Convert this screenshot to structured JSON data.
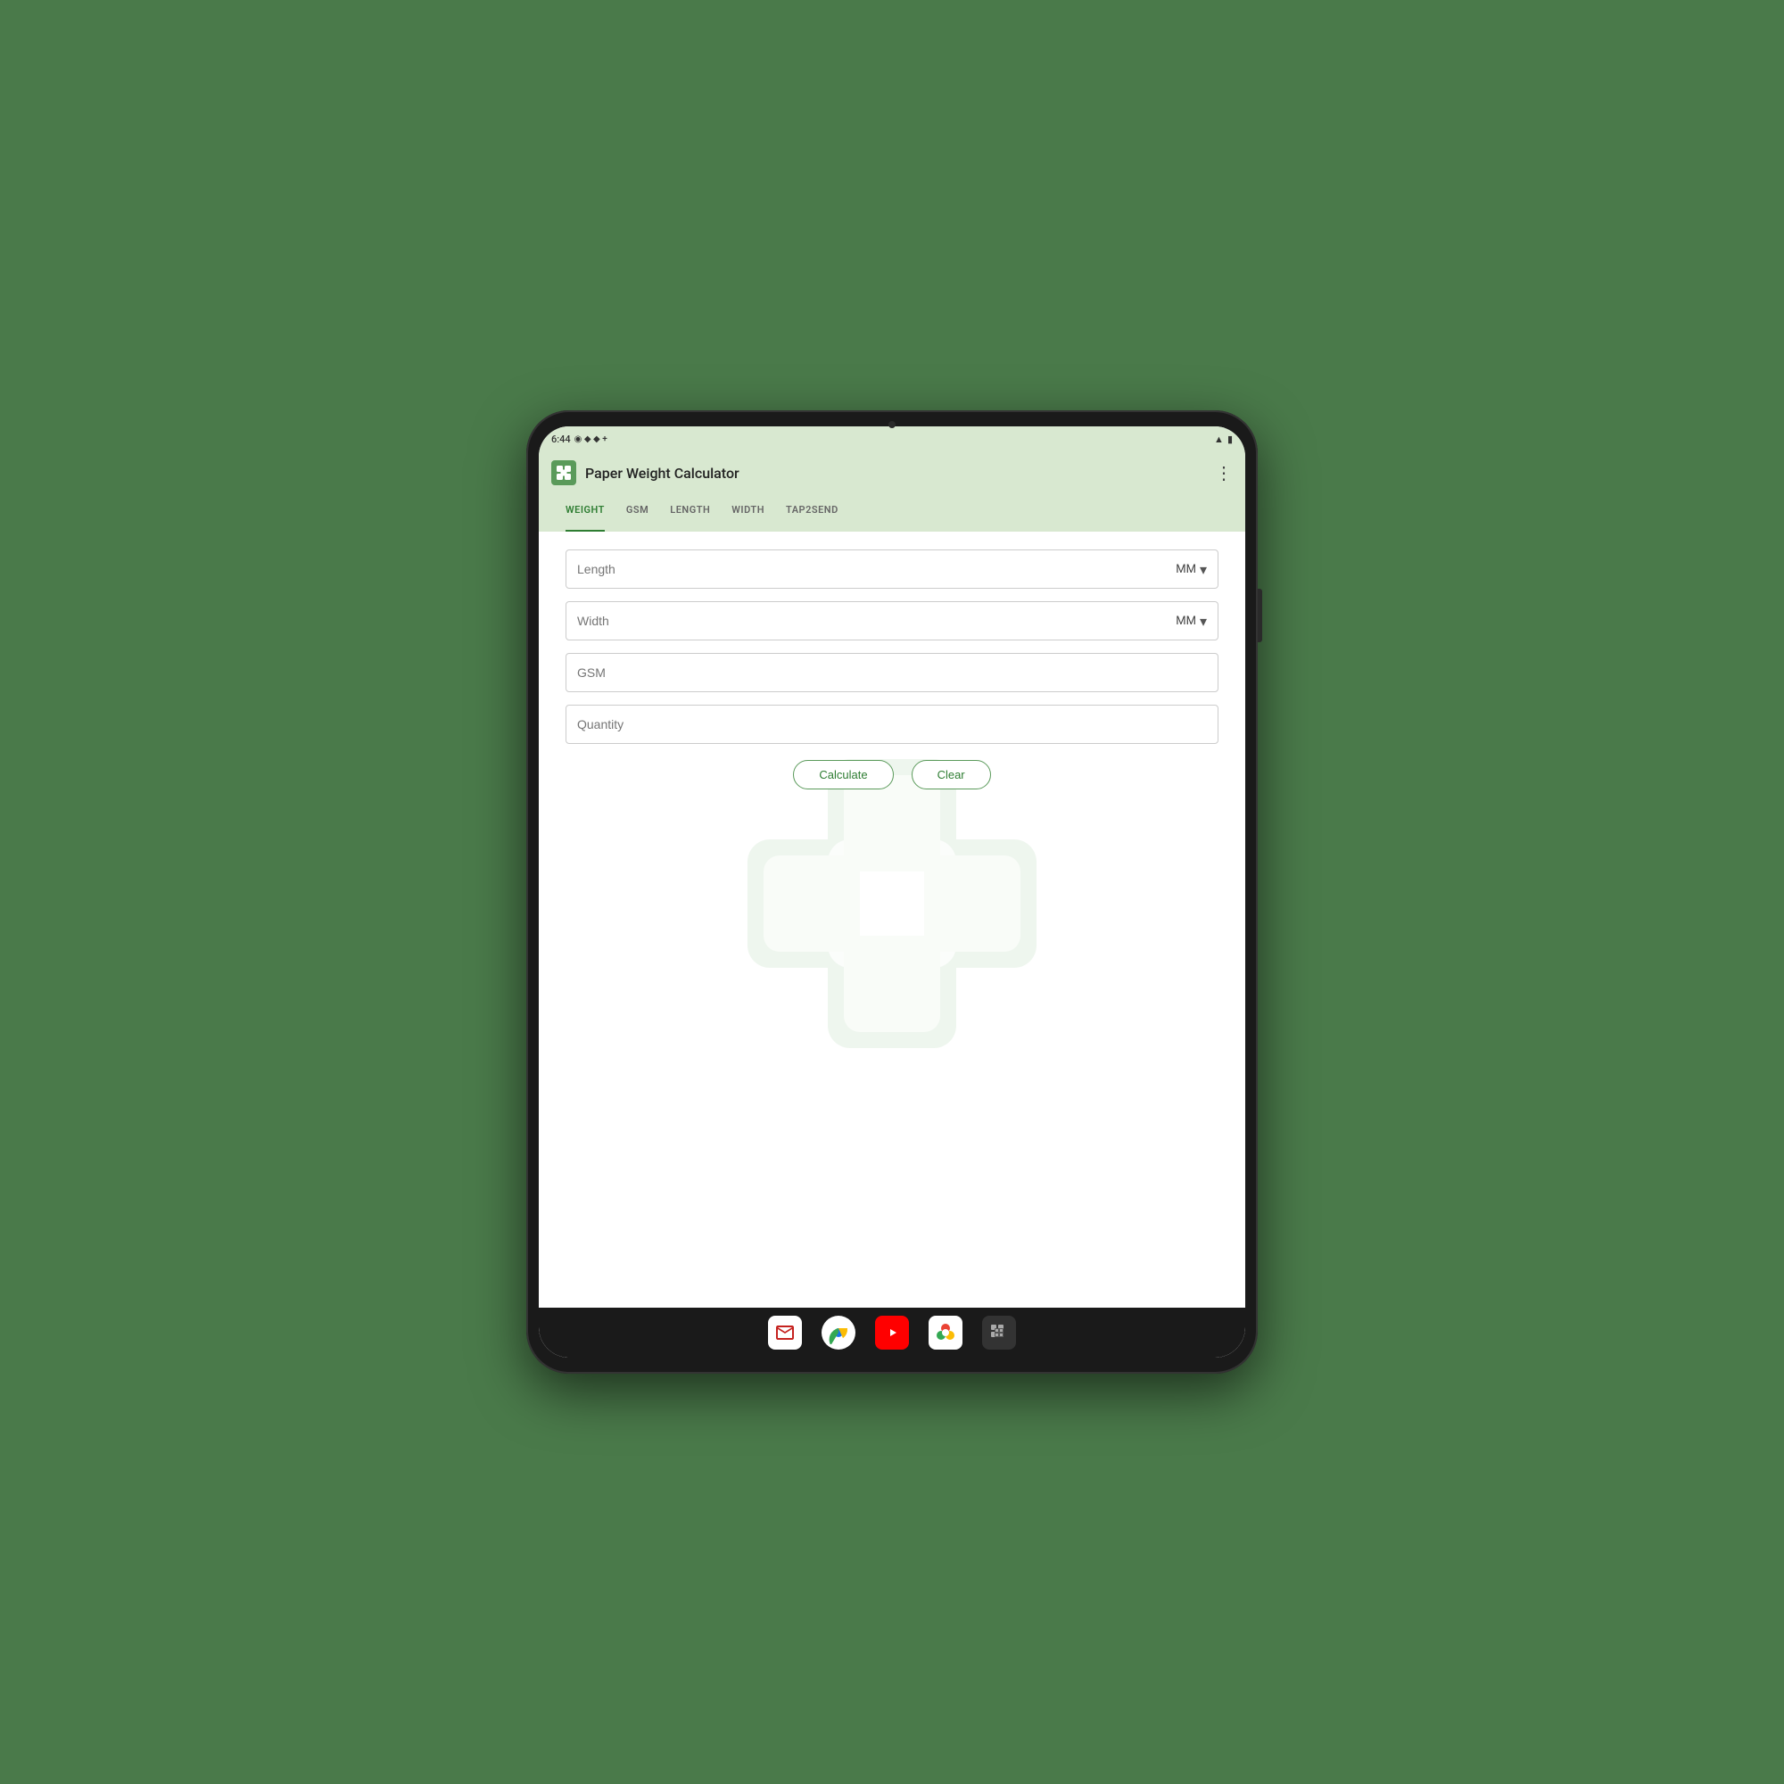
{
  "status_bar": {
    "time": "6:44",
    "icons_right": [
      "signal",
      "battery"
    ]
  },
  "app_bar": {
    "title": "Paper Weight Calculator",
    "more_label": "⋮"
  },
  "tabs": [
    {
      "id": "weight",
      "label": "WEIGHT",
      "active": true
    },
    {
      "id": "gsm",
      "label": "GSM",
      "active": false
    },
    {
      "id": "length",
      "label": "LENGTH",
      "active": false
    },
    {
      "id": "width",
      "label": "WIDTH",
      "active": false
    },
    {
      "id": "tap2send",
      "label": "TAP2SEND",
      "active": false
    }
  ],
  "form": {
    "length_placeholder": "Length",
    "length_unit": "MM",
    "width_placeholder": "Width",
    "width_unit": "MM",
    "gsm_placeholder": "GSM",
    "quantity_placeholder": "Quantity",
    "calculate_label": "Calculate",
    "clear_label": "Clear"
  },
  "bottom_dock": {
    "icons": [
      "gmail",
      "chrome",
      "youtube",
      "photos",
      "apps"
    ]
  }
}
